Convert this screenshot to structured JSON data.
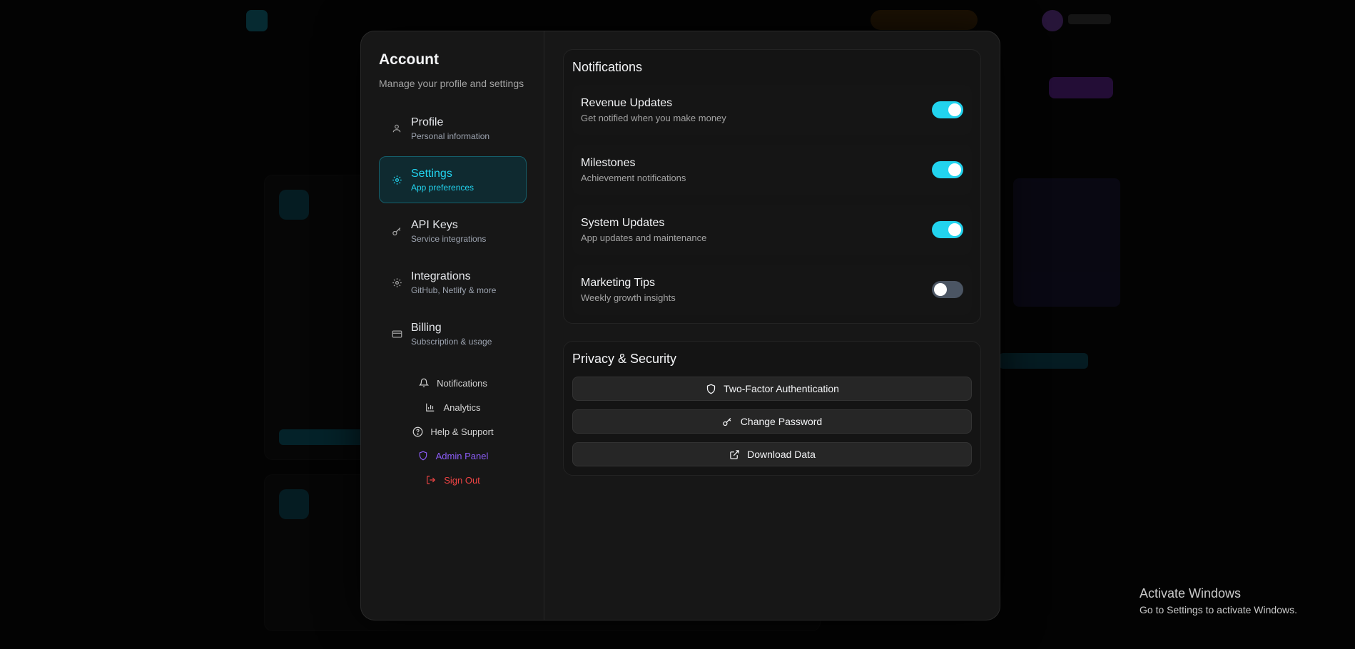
{
  "modal": {
    "title": "Account",
    "subtitle": "Manage your profile and settings",
    "nav": [
      {
        "label": "Profile",
        "desc": "Personal information",
        "icon": "user-icon"
      },
      {
        "label": "Settings",
        "desc": "App preferences",
        "icon": "gear-icon",
        "active": true
      },
      {
        "label": "API Keys",
        "desc": "Service integrations",
        "icon": "key-icon"
      },
      {
        "label": "Integrations",
        "desc": "GitHub, Netlify & more",
        "icon": "gear-icon"
      },
      {
        "label": "Billing",
        "desc": "Subscription & usage",
        "icon": "credit-card-icon"
      }
    ],
    "links": [
      {
        "label": "Notifications",
        "icon": "bell-icon"
      },
      {
        "label": "Analytics",
        "icon": "bar-chart-icon"
      },
      {
        "label": "Help & Support",
        "icon": "help-circle-icon"
      },
      {
        "label": "Admin Panel",
        "icon": "shield-icon",
        "color": "#8b5cf6"
      },
      {
        "label": "Sign Out",
        "icon": "logout-icon",
        "color": "#ef4444"
      }
    ]
  },
  "notifications": {
    "title": "Notifications",
    "items": [
      {
        "title": "Revenue Updates",
        "desc": "Get notified when you make money",
        "enabled": true
      },
      {
        "title": "Milestones",
        "desc": "Achievement notifications",
        "enabled": true
      },
      {
        "title": "System Updates",
        "desc": "App updates and maintenance",
        "enabled": true
      },
      {
        "title": "Marketing Tips",
        "desc": "Weekly growth insights",
        "enabled": false
      }
    ]
  },
  "privacy": {
    "title": "Privacy & Security",
    "buttons": [
      {
        "label": "Two-Factor Authentication",
        "icon": "shield-icon"
      },
      {
        "label": "Change Password",
        "icon": "key-icon"
      },
      {
        "label": "Download Data",
        "icon": "external-link-icon"
      }
    ]
  },
  "watermark": {
    "line1": "Activate Windows",
    "line2": "Go to Settings to activate Windows."
  },
  "colors": {
    "accent": "#22d3ee",
    "admin": "#8b5cf6",
    "danger": "#ef4444"
  }
}
